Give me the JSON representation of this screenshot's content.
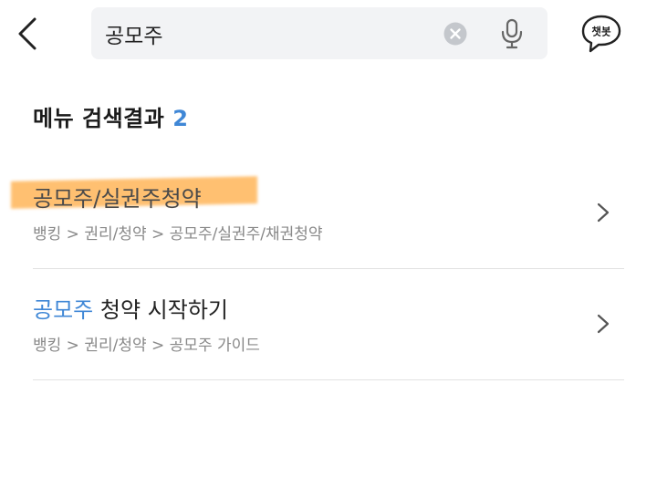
{
  "header": {
    "back_icon": "chevron-left-icon",
    "search": {
      "value": "공모주",
      "clear_icon": "clear-circle-icon",
      "mic_icon": "microphone-icon"
    },
    "chatbot": {
      "icon": "chat-bubble-icon",
      "label": "챗봇"
    }
  },
  "results": {
    "heading_label": "메뉴 검색결과",
    "count": "2",
    "items": [
      {
        "title_match": "공모주",
        "title_rest": "/실권주청약",
        "path": "뱅킹 > 권리/청약 > 공모주/실권주/채권청약",
        "highlighted": true
      },
      {
        "title_match": "공모주",
        "title_rest": " 청약 시작하기",
        "path": "뱅킹 > 권리/청약 > 공모주 가이드",
        "highlighted": false
      }
    ]
  },
  "colors": {
    "accent": "#3f87d6",
    "highlight": "#ffb252",
    "search_bg": "#f2f3f5",
    "divider": "#e2e2e2"
  }
}
